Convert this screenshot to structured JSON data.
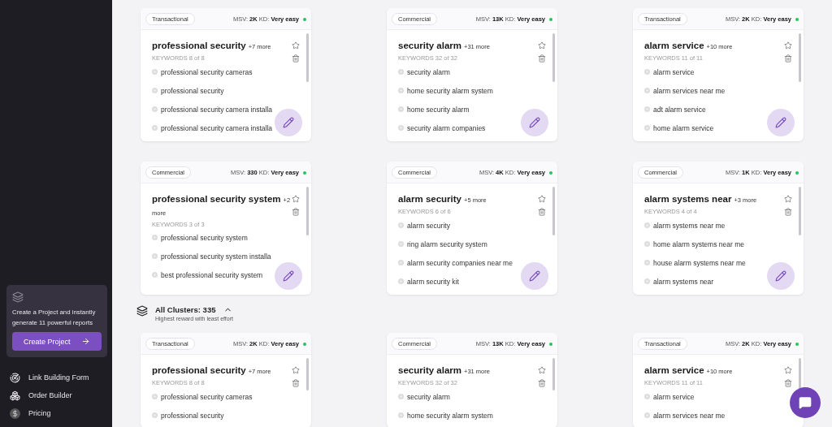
{
  "sidebar": {
    "promo": {
      "text": "Create a Project and instantly generate 11 powerful reports",
      "button": "Create Project"
    },
    "nav": [
      {
        "kind": "link",
        "label": "Link Building Form"
      },
      {
        "kind": "order",
        "label": "Order Builder"
      },
      {
        "kind": "pricing",
        "label": "Pricing"
      }
    ]
  },
  "top_clusters": [
    {
      "type": "Transactional",
      "msv_label": "MSV:",
      "msv": "2K",
      "kd_label": "KD:",
      "kd": "Very easy",
      "color": "#22c55e",
      "title": "professional security",
      "more": "+7 more",
      "count": "KEYWORDS 8 of 8",
      "keywords": [
        "professional security cameras",
        "professional security",
        "professional security camera installa",
        "professional security camera installa"
      ]
    },
    {
      "type": "Commercial",
      "msv_label": "MSV:",
      "msv": "13K",
      "kd_label": "KD:",
      "kd": "Very easy",
      "color": "#22c55e",
      "title": "security alarm",
      "more": "+31 more",
      "count": "KEYWORDS 32 of 32",
      "keywords": [
        "security alarm",
        "home security alarm system",
        "home security alarm",
        "security alarm companies"
      ]
    },
    {
      "type": "Transactional",
      "msv_label": "MSV:",
      "msv": "2K",
      "kd_label": "KD:",
      "kd": "Very easy",
      "color": "#22c55e",
      "title": "alarm service",
      "more": "+10 more",
      "count": "KEYWORDS 11 of 11",
      "keywords": [
        "alarm service",
        "alarm services near me",
        "adt alarm service",
        "home alarm service"
      ]
    },
    {
      "type": "Commercial",
      "msv_label": "MSV:",
      "msv": "330",
      "kd_label": "KD:",
      "kd": "Very easy",
      "color": "#22c55e",
      "title": "professional security system",
      "more": "+2 more",
      "count": "KEYWORDS 3 of 3",
      "keywords": [
        "professional security system",
        "professional security system installa",
        "best professional security system"
      ]
    },
    {
      "type": "Commercial",
      "msv_label": "MSV:",
      "msv": "4K",
      "kd_label": "KD:",
      "kd": "Very easy",
      "color": "#22c55e",
      "title": "alarm security",
      "more": "+5 more",
      "count": "KEYWORDS 6 of 6",
      "keywords": [
        "alarm security",
        "ring alarm security system",
        "alarm security companies near me",
        "alarm security kit"
      ]
    },
    {
      "type": "Commercial",
      "msv_label": "MSV:",
      "msv": "1K",
      "kd_label": "KD:",
      "kd": "Very easy",
      "color": "#22c55e",
      "title": "alarm systems near",
      "more": "+3 more",
      "count": "KEYWORDS 4 of 4",
      "keywords": [
        "alarm systems near me",
        "home alarm systems near me",
        "house alarm systems near me",
        "alarm systems near"
      ]
    }
  ],
  "section": {
    "title": "All Clusters: 335",
    "subtitle": "Highest reward with least effort",
    "expanded": true
  },
  "all_clusters": [
    {
      "type": "Transactional",
      "msv_label": "MSV:",
      "msv": "2K",
      "kd_label": "KD:",
      "kd": "Very easy",
      "color": "#22c55e",
      "title": "professional security",
      "more": "+7 more",
      "count": "KEYWORDS 8 of 8",
      "keywords": [
        "professional security cameras",
        "professional security"
      ]
    },
    {
      "type": "Commercial",
      "msv_label": "MSV:",
      "msv": "13K",
      "kd_label": "KD:",
      "kd": "Very easy",
      "color": "#22c55e",
      "title": "security alarm",
      "more": "+31 more",
      "count": "KEYWORDS 32 of 32",
      "keywords": [
        "security alarm",
        "home security alarm system"
      ]
    },
    {
      "type": "Transactional",
      "msv_label": "MSV:",
      "msv": "2K",
      "kd_label": "KD:",
      "kd": "Very easy",
      "color": "#22c55e",
      "title": "alarm service",
      "more": "+10 more",
      "count": "KEYWORDS 11 of 11",
      "keywords": [
        "alarm service",
        "alarm services near me"
      ]
    }
  ]
}
